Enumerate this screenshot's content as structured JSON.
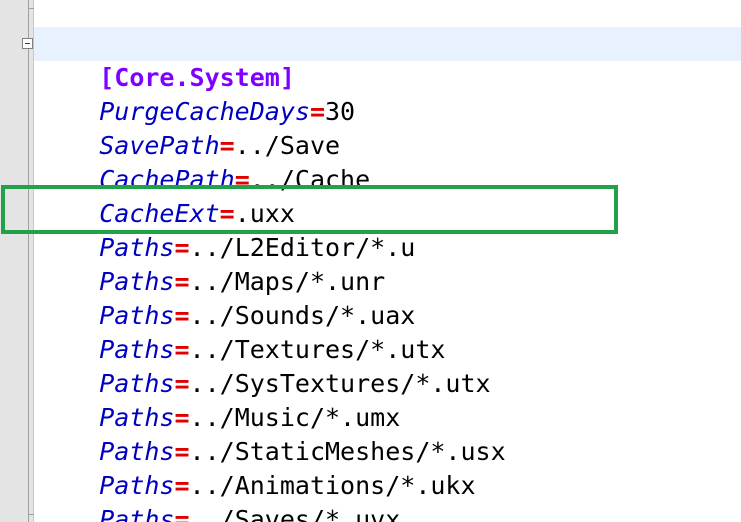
{
  "editor": {
    "section_header": "[Core.System]",
    "highlight_color": "#21a148",
    "colors": {
      "section": "#8000ff",
      "key": "#0000c0",
      "equals": "#e00000",
      "value": "#000000",
      "current_line": "#e8f2fe"
    },
    "lines": [
      {
        "key": "PurgeCacheDays",
        "eq": "=",
        "value": "30"
      },
      {
        "key": "SavePath",
        "eq": "=",
        "value": "../Save"
      },
      {
        "key": "CachePath",
        "eq": "=",
        "value": "../Cache"
      },
      {
        "key": "CacheExt",
        "eq": "=",
        "value": ".uxx"
      },
      {
        "key": "Paths",
        "eq": "=",
        "value": "../L2Editor/*.u",
        "highlighted": true
      },
      {
        "key": "Paths",
        "eq": "=",
        "value": "../Maps/*.unr"
      },
      {
        "key": "Paths",
        "eq": "=",
        "value": "../Sounds/*.uax"
      },
      {
        "key": "Paths",
        "eq": "=",
        "value": "../Textures/*.utx"
      },
      {
        "key": "Paths",
        "eq": "=",
        "value": "../SysTextures/*.utx"
      },
      {
        "key": "Paths",
        "eq": "=",
        "value": "../Music/*.umx"
      },
      {
        "key": "Paths",
        "eq": "=",
        "value": "../StaticMeshes/*.usx"
      },
      {
        "key": "Paths",
        "eq": "=",
        "value": "../Animations/*.ukx"
      },
      {
        "key": "Paths",
        "eq": "=",
        "value": "../Saves/*.uvx"
      }
    ]
  }
}
